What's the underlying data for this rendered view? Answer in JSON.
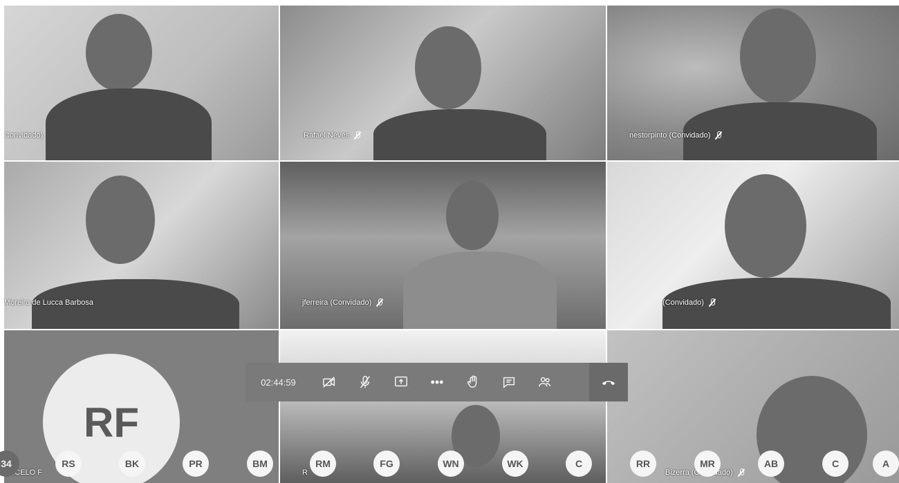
{
  "participants": [
    {
      "name": "Convidado)"
    },
    {
      "name": "Rafael Neves"
    },
    {
      "name": "nestorpinto (Convidado)"
    },
    {
      "name": "Moreira de Lucca Barbosa"
    },
    {
      "name": "jferreira (Convidado)"
    },
    {
      "name": "(Convidado)"
    },
    {
      "name": "ARCELO F",
      "initials": "RF"
    },
    {
      "name": "R"
    },
    {
      "name": "Bizerra (Convidado)"
    }
  ],
  "toolbar": {
    "timer": "02:44:59",
    "buttons": [
      "camera-off",
      "mic-off",
      "share-screen",
      "more-options",
      "raise-hand",
      "chat",
      "participants"
    ],
    "hangup": "hang-up",
    "more_label": "•••"
  },
  "avatars": [
    "34",
    "RS",
    "BK",
    "PR",
    "BM",
    "RM",
    "FG",
    "WN",
    "WK",
    "C",
    "RR",
    "MR",
    "AB",
    "C",
    "A"
  ]
}
